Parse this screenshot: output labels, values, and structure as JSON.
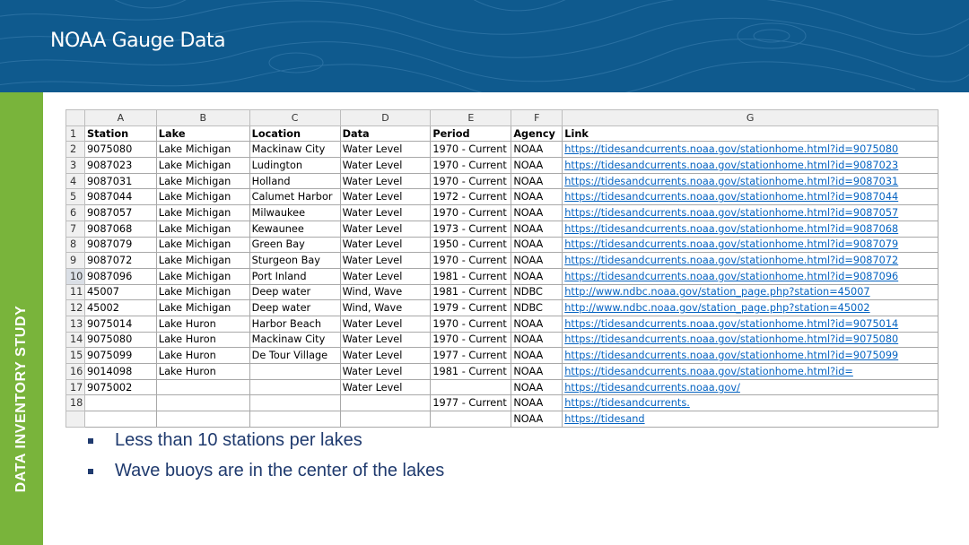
{
  "slide": {
    "title": "NOAA Gauge Data",
    "side_label": "DATA INVENTORY STUDY",
    "colors": {
      "header": "#0f5a8e",
      "sidebar": "#79b43b",
      "text": "#1f3a6e",
      "link": "#0563c1"
    }
  },
  "spreadsheet": {
    "column_letters": [
      "A",
      "B",
      "C",
      "D",
      "E",
      "F",
      "G"
    ],
    "rows": [
      {
        "n": "1",
        "cells": [
          "Station",
          "Lake",
          "Location",
          "Data",
          "Period",
          "Agency",
          "Link"
        ]
      },
      {
        "n": "2",
        "cells": [
          "9075080",
          "Lake Michigan",
          "Mackinaw City",
          "Water Level",
          "1970 - Current",
          "NOAA",
          "https://tidesandcurrents.noaa.gov/stationhome.html?id=9075080"
        ]
      },
      {
        "n": "3",
        "cells": [
          "9087023",
          "Lake Michigan",
          "Ludington",
          "Water Level",
          "1970 - Current",
          "NOAA",
          "https://tidesandcurrents.noaa.gov/stationhome.html?id=9087023"
        ]
      },
      {
        "n": "4",
        "cells": [
          "9087031",
          "Lake Michigan",
          "Holland",
          "Water Level",
          "1970 - Current",
          "NOAA",
          "https://tidesandcurrents.noaa.gov/stationhome.html?id=9087031"
        ]
      },
      {
        "n": "5",
        "cells": [
          "9087044",
          "Lake Michigan",
          "Calumet Harbor",
          "Water Level",
          "1972 - Current",
          "NOAA",
          "https://tidesandcurrents.noaa.gov/stationhome.html?id=9087044"
        ]
      },
      {
        "n": "6",
        "cells": [
          "9087057",
          "Lake Michigan",
          "Milwaukee",
          "Water Level",
          "1970 - Current",
          "NOAA",
          "https://tidesandcurrents.noaa.gov/stationhome.html?id=9087057"
        ]
      },
      {
        "n": "7",
        "cells": [
          "9087068",
          "Lake Michigan",
          "Kewaunee",
          "Water Level",
          "1973 - Current",
          "NOAA",
          "https://tidesandcurrents.noaa.gov/stationhome.html?id=9087068"
        ]
      },
      {
        "n": "8",
        "cells": [
          "9087079",
          "Lake Michigan",
          "Green Bay",
          "Water Level",
          "1950 - Current",
          "NOAA",
          "https://tidesandcurrents.noaa.gov/stationhome.html?id=9087079"
        ]
      },
      {
        "n": "9",
        "cells": [
          "9087072",
          "Lake Michigan",
          "Sturgeon Bay",
          "Water Level",
          "1970 - Current",
          "NOAA",
          "https://tidesandcurrents.noaa.gov/stationhome.html?id=9087072"
        ]
      },
      {
        "n": "10",
        "cells": [
          "9087096",
          "Lake Michigan",
          "Port Inland",
          "Water Level",
          "1981 - Current",
          "NOAA",
          "https://tidesandcurrents.noaa.gov/stationhome.html?id=9087096"
        ]
      },
      {
        "n": "11",
        "cells": [
          "45007",
          "Lake Michigan",
          "Deep water",
          "Wind, Wave",
          "1981 - Current",
          "NDBC",
          "http://www.ndbc.noaa.gov/station_page.php?station=45007"
        ]
      },
      {
        "n": "12",
        "cells": [
          "45002",
          "Lake Michigan",
          "Deep water",
          "Wind, Wave",
          "1979 - Current",
          "NDBC",
          "http://www.ndbc.noaa.gov/station_page.php?station=45002"
        ]
      },
      {
        "n": "13",
        "cells": [
          "9075014",
          "Lake Huron",
          "Harbor Beach",
          "Water Level",
          "1970 - Current",
          "NOAA",
          "https://tidesandcurrents.noaa.gov/stationhome.html?id=9075014"
        ]
      },
      {
        "n": "14",
        "cells": [
          "9075080",
          "Lake Huron",
          "Mackinaw City",
          "Water Level",
          "1970 - Current",
          "NOAA",
          "https://tidesandcurrents.noaa.gov/stationhome.html?id=9075080"
        ]
      },
      {
        "n": "15",
        "cells": [
          "9075099",
          "Lake Huron",
          "De Tour Village",
          "Water Level",
          "1977 - Current",
          "NOAA",
          "https://tidesandcurrents.noaa.gov/stationhome.html?id=9075099"
        ]
      },
      {
        "n": "16",
        "cells": [
          "9014098",
          "Lake Huron",
          "",
          "Water Level",
          "1981 - Current",
          "NOAA",
          "https://tidesandcurrents.noaa.gov/stationhome.html?id="
        ]
      },
      {
        "n": "17",
        "cells": [
          "9075002",
          "",
          "",
          "Water Level",
          "",
          "NOAA",
          "https://tidesandcurrents.noaa.gov/"
        ]
      },
      {
        "n": "18",
        "cells": [
          "",
          "",
          "",
          "",
          "1977 - Current",
          "NOAA",
          "https://tidesandcurrents."
        ]
      },
      {
        "n": "",
        "cells": [
          "",
          "",
          "",
          "",
          "",
          "NOAA",
          "https://tidesand"
        ]
      }
    ]
  },
  "bullets": [
    "Less than 10 stations per lakes",
    "Wave buoys are in the center of the lakes"
  ]
}
